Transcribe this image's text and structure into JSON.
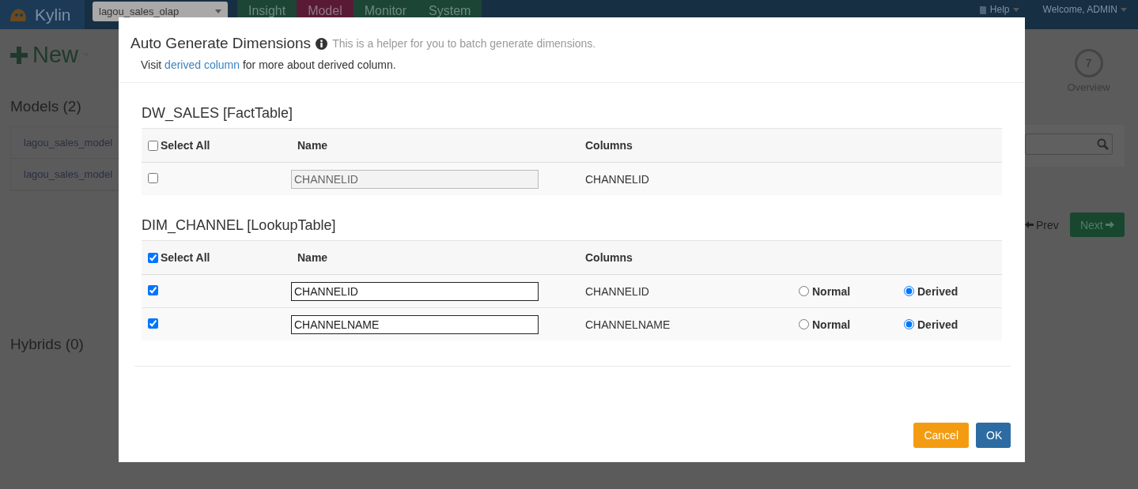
{
  "navbar": {
    "brand": "Kylin",
    "project": "lagou_sales_olap",
    "tabs": [
      {
        "label": "Insight",
        "selected": false
      },
      {
        "label": "Model",
        "selected": true
      },
      {
        "label": "Monitor",
        "selected": false
      },
      {
        "label": "System",
        "selected": false
      }
    ],
    "help": "Help",
    "welcome": "Welcome, ADMIN"
  },
  "sidebar": {
    "new_button": "New",
    "models_heading": "Models (2)",
    "models": [
      "lagou_sales_model",
      "lagou_sales_model"
    ],
    "hybrids_heading": "Hybrids (0)"
  },
  "wizard": {
    "step": "7",
    "step_label": "Overview",
    "prev_button": "Prev",
    "next_button": "Next"
  },
  "dialog": {
    "title": "Auto Generate Dimensions",
    "hint": "This is a helper for you to batch generate dimensions.",
    "note_before": "Visit",
    "note_link": "derived column",
    "note_after": "for more about derived column.",
    "tables": [
      {
        "heading": "DW_SALES [FactTable]",
        "select_all": {
          "label": "Select All",
          "checked": false
        },
        "columns": [
          "Name",
          "Columns"
        ],
        "rows": [
          {
            "checked": false,
            "name": "CHANNELID",
            "column": "CHANNELID"
          }
        ]
      },
      {
        "heading": "DIM_CHANNEL [LookupTable]",
        "select_all": {
          "label": "Select All",
          "checked": true
        },
        "columns": [
          "Name",
          "Columns"
        ],
        "rows": [
          {
            "checked": true,
            "name": "CHANNELID",
            "column": "CHANNELID",
            "options": [
              {
                "label": "Normal",
                "selected": false
              },
              {
                "label": "Derived",
                "selected": true
              }
            ]
          },
          {
            "checked": true,
            "name": "CHANNELNAME",
            "column": "CHANNELNAME",
            "options": [
              {
                "label": "Normal",
                "selected": false
              },
              {
                "label": "Derived",
                "selected": true
              }
            ]
          }
        ]
      }
    ],
    "buttons": [
      {
        "label": "Cancel",
        "kind": "cancel"
      },
      {
        "label": "OK",
        "kind": "primary"
      }
    ]
  }
}
